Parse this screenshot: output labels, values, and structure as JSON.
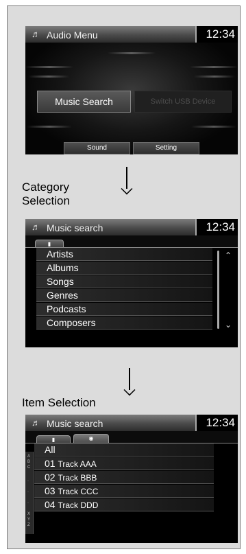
{
  "screen1": {
    "title": "Audio Menu",
    "clock": "12:34",
    "music_search_label": "Music Search",
    "switch_usb_label": "Switch USB Device",
    "sound_label": "Sound",
    "setting_label": "Setting"
  },
  "label_category": "Category\nSelection",
  "screen2": {
    "title": "Music search",
    "clock": "12:34",
    "tab_icon": "usb-icon",
    "items": [
      "Artists",
      "Albums",
      "Songs",
      "Genres",
      "Podcasts",
      "Composers"
    ]
  },
  "label_item": "Item Selection",
  "screen3": {
    "title": "Music search",
    "clock": "12:34",
    "tab_icons": [
      "usb-icon",
      "disc-icon"
    ],
    "all_label": "All",
    "tracks": [
      {
        "num": "01",
        "title": "Track AAA"
      },
      {
        "num": "02",
        "title": "Track BBB"
      },
      {
        "num": "03",
        "title": "Track CCC"
      },
      {
        "num": "04",
        "title": "Track DDD"
      }
    ],
    "alpha_index": [
      "A",
      "B",
      "C",
      "·",
      "·",
      "·",
      "X",
      "Y",
      "Z"
    ]
  },
  "colors": {
    "bar": "#4a4a4a",
    "screen_bg": "#000000",
    "panel_bg": "#dcdcdc"
  }
}
